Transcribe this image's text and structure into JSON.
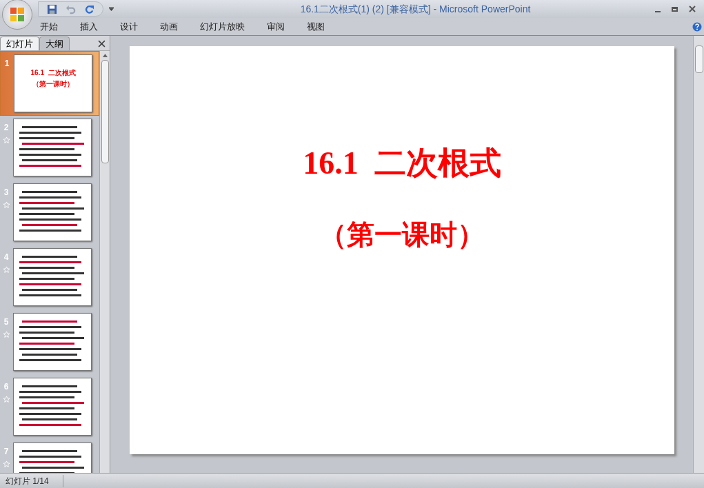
{
  "window": {
    "title": "16.1二次根式(1) (2) [兼容模式] - Microsoft PowerPoint"
  },
  "ribbon_tabs": [
    "开始",
    "插入",
    "设计",
    "动画",
    "幻灯片放映",
    "审阅",
    "视图"
  ],
  "pane_tabs": [
    {
      "label": "幻灯片",
      "selected": true
    },
    {
      "label": "大纲",
      "selected": false
    }
  ],
  "slides": [
    {
      "number": "1",
      "selected": true,
      "animated": false,
      "lines": [
        "16.1  二次根式",
        "（第一课时）"
      ]
    },
    {
      "number": "2",
      "selected": false,
      "animated": true
    },
    {
      "number": "3",
      "selected": false,
      "animated": true
    },
    {
      "number": "4",
      "selected": false,
      "animated": true
    },
    {
      "number": "5",
      "selected": false,
      "animated": true
    },
    {
      "number": "6",
      "selected": false,
      "animated": true
    },
    {
      "number": "7",
      "selected": false,
      "animated": true
    }
  ],
  "slide": {
    "title": "16.1  二次根式",
    "subtitle": "（第一课时）"
  },
  "status_bar": {
    "text": "幻灯片 1/14"
  }
}
